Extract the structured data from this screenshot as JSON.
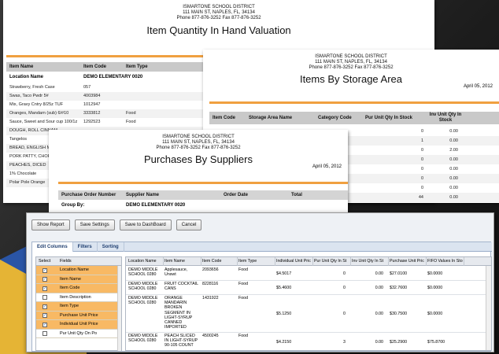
{
  "district": {
    "name": "ISMARTONE SCHOOL DISTRICT",
    "address": "111 MAIN ST, NAPLES, FL, 34134",
    "phone": "Phone 877-876-3252     Fax 877-876-3252"
  },
  "report1": {
    "title": "Item Quantity In Hand Valuation",
    "headers": [
      "Item Name",
      "Item Code",
      "Item Type"
    ],
    "group_label": "Location Name",
    "group_value": "DEMO ELEMENTARY 0020",
    "rows": [
      [
        "Strawberry, Fresh Case",
        "057",
        ""
      ],
      [
        "Swas, Taco Pwdr  5#",
        "4003984",
        ""
      ],
      [
        "Mix, Gravy Cntry 8/25z TUF",
        "1012947",
        ""
      ],
      [
        "Oranges, Mandarn (sub) 6/#10",
        "3333812",
        "Food"
      ],
      [
        "Sauce, Sweet and Sour cup 100/1z",
        "1292523",
        "Food"
      ],
      [
        "DOUGH, ROLL CINNAM",
        "",
        ""
      ],
      [
        "Tangelos",
        "",
        ""
      ],
      [
        "BREAD, ENGLISH MUFF",
        "",
        ""
      ],
      [
        "PORK PATTY, CHOP 4O",
        "",
        ""
      ],
      [
        "PEACHES, DICED",
        "",
        ""
      ],
      [
        "1% Chocolate",
        "",
        ""
      ],
      [
        "Polar Pole Orange",
        "",
        ""
      ]
    ]
  },
  "report2": {
    "title": "Items By Storage Area",
    "date": "April 05, 2012",
    "headers": [
      "Item Code",
      "Storage Area Name",
      "Category Code",
      "Pur Unit Qty In Stock",
      "Inv Unit Qty In Stock"
    ],
    "rows": [
      [
        "0",
        "0.00"
      ],
      [
        "1",
        "0.00"
      ],
      [
        "0",
        "2.00"
      ],
      [
        "0",
        "0.00"
      ],
      [
        "0",
        "0.00"
      ],
      [
        "0",
        "0.00"
      ],
      [
        "0",
        "0.00"
      ],
      [
        "44",
        "0.00"
      ],
      [
        "1",
        "0.00"
      ]
    ]
  },
  "report3": {
    "title": "Purchases By Suppliers",
    "date": "April 05, 2012",
    "headers": [
      "Purchase Order Number",
      "Supplier Name",
      "Order Date",
      "Total"
    ],
    "group_label": "Group By:",
    "group_value": "DEMO ELEMENTARY 0020"
  },
  "toolbar": {
    "show_report": "Show Report",
    "save_settings": "Save Settings",
    "save_dashboard": "Save to DashBoard",
    "cancel": "Cancel"
  },
  "tabs": [
    "Edit Columns",
    "Filters",
    "Sorting"
  ],
  "selector": {
    "headers": [
      "Select",
      "Fields"
    ],
    "fields": [
      {
        "label": "Location Name",
        "checked": true
      },
      {
        "label": "Item Name",
        "checked": true
      },
      {
        "label": "Item Code",
        "checked": true
      },
      {
        "label": "Item Description",
        "checked": false
      },
      {
        "label": "Item Type",
        "checked": true
      },
      {
        "label": "Purchase Unit Price",
        "checked": true
      },
      {
        "label": "Individual Unit Price",
        "checked": true
      },
      {
        "label": "Pur Unit Qty On Po",
        "checked": false
      }
    ]
  },
  "grid": {
    "headers": [
      "Location Name",
      "Item Name",
      "Item Code",
      "Item Type",
      "Individual Unit Pric",
      "Pur Unit Qty In St",
      "Inv Unit Qty In St",
      "Purchase Unit Pric",
      "FIFO Values In Sto"
    ],
    "rows": [
      [
        "DEMO MIDDLE SCHOOL 0280",
        "Applesauce, Unswt",
        "2093656",
        "Food",
        "$4.5017",
        "0",
        "0.00",
        "$27.0100",
        "$0.0000"
      ],
      [
        "DEMO MIDDLE SCHOOL 0280",
        "FRUIT COCKTAIL CANS",
        "8228116",
        "Food",
        "$5.4600",
        "0",
        "0.00",
        "$32.7600",
        "$0.0000"
      ],
      [
        "DEMO MIDDLE SCHOOL 0280",
        "ORANGE MANDARIN BROKEN SEGMENT IN LIGHT-SYRUP CANNED IMPORTED",
        "1431922",
        "Food",
        "$5.1250",
        "0",
        "0.00",
        "$30.7500",
        "$0.0000"
      ],
      [
        "DEMO MIDDLE SCHOOL 0280",
        "PEACH SLICED IN LIGHT-SYRUP 90-105 COUNT",
        "4500245",
        "Food",
        "$4.2150",
        "3",
        "0.00",
        "$25.2900",
        "$75.8700"
      ]
    ]
  }
}
